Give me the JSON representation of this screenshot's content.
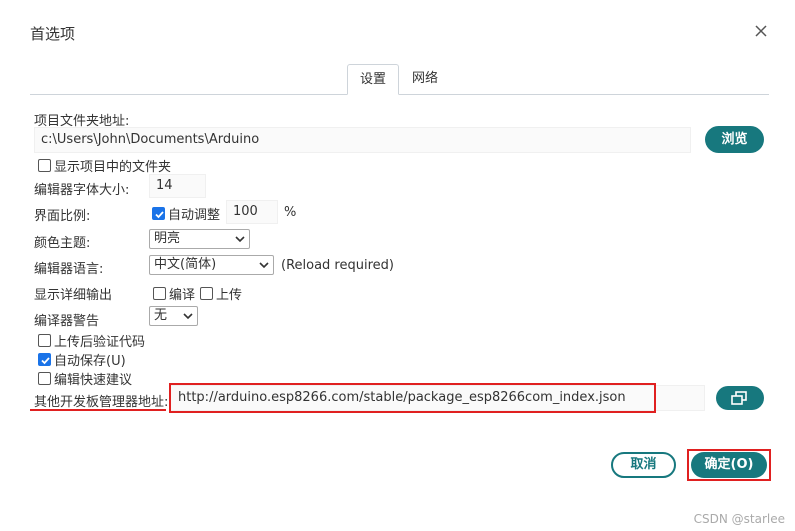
{
  "dialog": {
    "title": "首选项"
  },
  "tabs": [
    {
      "label": "设置",
      "active": true
    },
    {
      "label": "网络",
      "active": false
    }
  ],
  "sketchbook": {
    "label": "项目文件夹地址:",
    "value": "c:\\Users\\John\\Documents\\Arduino",
    "browse_label": "浏览"
  },
  "show_files": {
    "label": "显示项目中的文件夹",
    "checked": false
  },
  "font_size": {
    "label": "编辑器字体大小:",
    "value": "14"
  },
  "scale": {
    "label": "界面比例:",
    "auto_label": "自动调整",
    "auto_checked": true,
    "value": "100",
    "unit": "%"
  },
  "theme": {
    "label": "颜色主题:",
    "value": "明亮"
  },
  "language": {
    "label": "编辑器语言:",
    "value": "中文(简体)",
    "note": "(Reload required)"
  },
  "verbose": {
    "label": "显示详细输出",
    "compile_label": "编译",
    "compile_checked": false,
    "upload_label": "上传",
    "upload_checked": false
  },
  "warnings": {
    "label": "编译器警告",
    "value": "无"
  },
  "verify_after_upload": {
    "label": "上传后验证代码",
    "checked": false
  },
  "auto_save": {
    "label": "自动保存(U)",
    "checked": true
  },
  "quick_suggestions": {
    "label": "编辑快速建议",
    "checked": false
  },
  "board_urls": {
    "label": "其他开发板管理器地址:",
    "value": "http://arduino.esp8266.com/stable/package_esp8266com_index.json"
  },
  "footer": {
    "cancel_label": "取消",
    "ok_label": "确定(O)"
  },
  "watermark": "CSDN @starlee",
  "colors": {
    "accent": "#17787e",
    "checkbox": "#1a73e8",
    "highlight": "#e02020"
  }
}
